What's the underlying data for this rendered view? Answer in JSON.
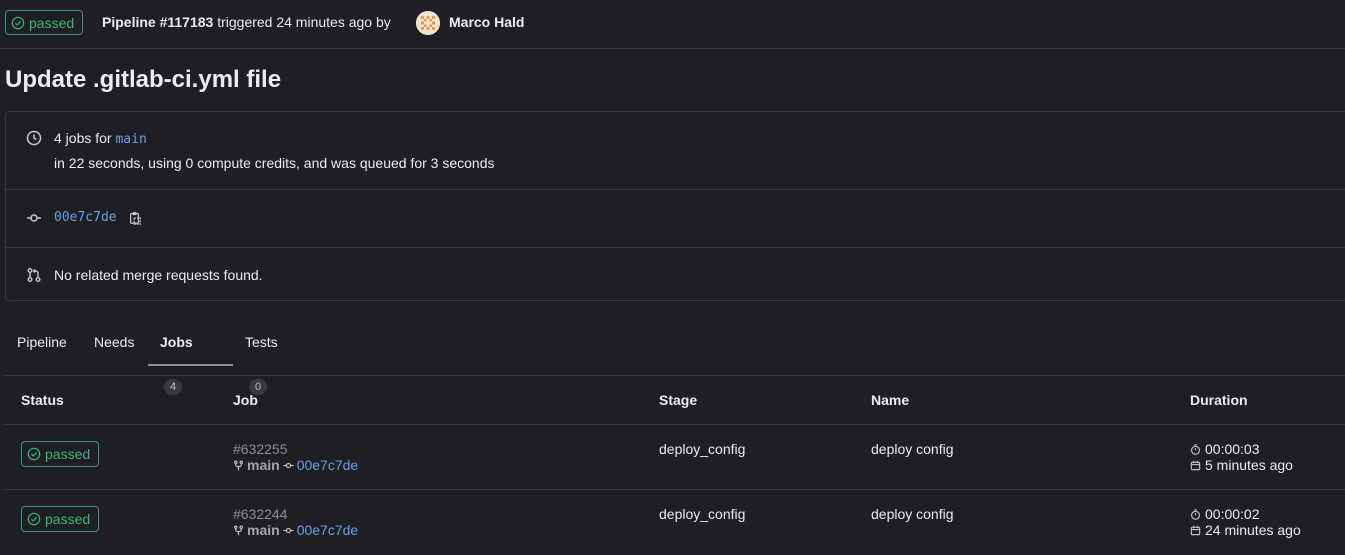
{
  "header": {
    "status": "passed",
    "pipeline": "Pipeline #117183",
    "triggered": "triggered 24 minutes ago by",
    "author": "Marco Hald"
  },
  "title": "Update .gitlab-ci.yml file",
  "info": {
    "jobs_prefix": "4 jobs for",
    "branch": "main",
    "duration_line": "in 22 seconds, using 0 compute credits, and was queued for 3 seconds",
    "commit": "00e7c7de",
    "merge_requests": "No related merge requests found."
  },
  "tabs": [
    {
      "label": "Pipeline"
    },
    {
      "label": "Needs"
    },
    {
      "label": "Jobs",
      "count": "4"
    },
    {
      "label": "Tests",
      "count": "0"
    }
  ],
  "table": {
    "headers": [
      "Status",
      "Job",
      "Stage",
      "Name",
      "Duration"
    ],
    "rows": [
      {
        "status": "passed",
        "job_id": "#632255",
        "branch": "main",
        "commit": "00e7c7de",
        "stage": "deploy_config",
        "name": "deploy config",
        "duration": "00:00:03",
        "finished": "5 minutes ago"
      },
      {
        "status": "passed",
        "job_id": "#632244",
        "branch": "main",
        "commit": "00e7c7de",
        "stage": "deploy_config",
        "name": "deploy config",
        "duration": "00:00:02",
        "finished": "24 minutes ago"
      }
    ]
  },
  "colors": {
    "accent_link": "#6c9ee8",
    "success": "#3fb37a",
    "background": "#1f1e24"
  }
}
